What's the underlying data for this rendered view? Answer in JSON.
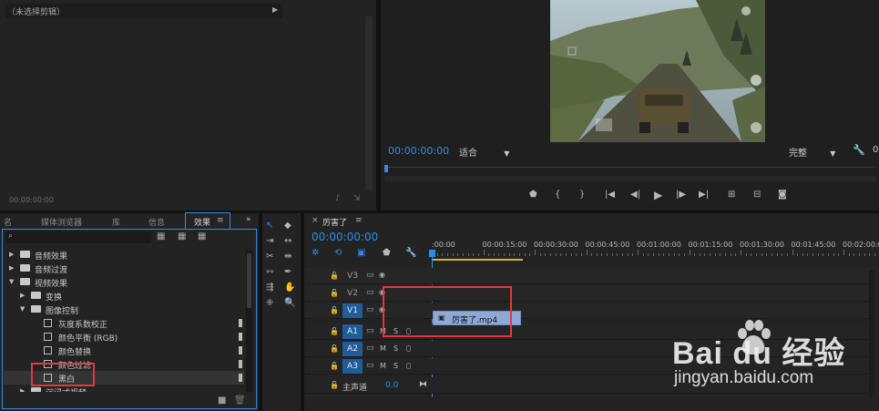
{
  "source_panel": {
    "header": "（未选择剪辑）",
    "timecode": "00:00:00:00"
  },
  "program_monitor": {
    "timecode": "00:00:00:00",
    "fit_label": "适合",
    "quality_label": "完整",
    "partial_right": "0"
  },
  "effects_panel": {
    "tabs": [
      "名",
      "媒体浏览器",
      "库",
      "信息",
      "效果"
    ],
    "active_tab": "效果",
    "tree": [
      {
        "label": "音频效果",
        "level": 0,
        "expanded": false,
        "type": "folder"
      },
      {
        "label": "音频过渡",
        "level": 0,
        "expanded": false,
        "type": "folder"
      },
      {
        "label": "视频效果",
        "level": 0,
        "expanded": true,
        "type": "folder"
      },
      {
        "label": "变换",
        "level": 1,
        "expanded": false,
        "type": "folder"
      },
      {
        "label": "图像控制",
        "level": 1,
        "expanded": true,
        "type": "folder"
      },
      {
        "label": "灰度系数校正",
        "level": 2,
        "type": "effect"
      },
      {
        "label": "颜色平衡 (RGB)",
        "level": 2,
        "type": "effect"
      },
      {
        "label": "颜色替换",
        "level": 2,
        "type": "effect"
      },
      {
        "label": "颜色过滤",
        "level": 2,
        "type": "effect"
      },
      {
        "label": "黑白",
        "level": 2,
        "type": "effect",
        "selected": true
      },
      {
        "label": "沉浸式视频",
        "level": 1,
        "expanded": false,
        "type": "folder"
      }
    ]
  },
  "timeline": {
    "sequence_name": "厉害了",
    "timecode": "00:00:00:00",
    "ruler": [
      ":00:00",
      "00:00:15:00",
      "00:00:30:00",
      "00:00:45:00",
      "00:01:00:00",
      "00:01:15:00",
      "00:01:30:00",
      "00:01:45:00",
      "00:02:00:00",
      "00"
    ],
    "video_tracks": [
      "V3",
      "V2",
      "V1"
    ],
    "audio_tracks": [
      "A1",
      "A2",
      "A3"
    ],
    "mute_label": "M",
    "solo_label": "S",
    "master_label": "主声道",
    "master_value": "0.0",
    "clip_name": "厉害了.mp4"
  },
  "watermark": {
    "brand": "Bai du 经验",
    "url": "jingyan.baidu.com"
  },
  "colors": {
    "accent": "#2d8ceb",
    "clip": "#8fa9d6",
    "highlight": "#e0393e"
  }
}
